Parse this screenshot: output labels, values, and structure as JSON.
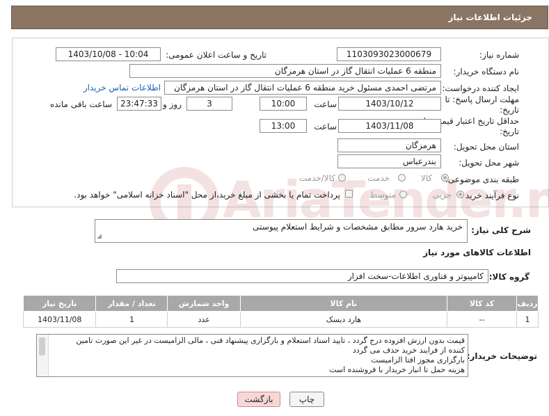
{
  "header": {
    "title": "جزئیات اطلاعات نیاز"
  },
  "form": {
    "need_number": {
      "label": "شماره نیاز:",
      "value": "1103093023000679"
    },
    "announce": {
      "label": "تاریخ و ساعت اعلان عمومی:",
      "value": "1403/10/08 - 10:04"
    },
    "buyer_org": {
      "label": "نام دستگاه خریدار:",
      "value": "منطقه 6 عملیات انتقال گاز در استان هرمزگان"
    },
    "creator": {
      "label": "ایجاد کننده درخواست:",
      "value": "مرتضی احمدی مسئول خرید منطقه 6 عملیات انتقال گاز در استان هرمزگان",
      "contact_link": "اطلاعات تماس خریدار"
    },
    "deadline": {
      "label_line1": "مهلت ارسال پاسخ: تا",
      "label_line2": "تاریخ:",
      "date": "1403/10/12",
      "time_label": "ساعت",
      "time": "10:00",
      "days": "3",
      "days_label": "روز و",
      "remaining": "23:47:33",
      "remaining_label": "ساعت باقی مانده"
    },
    "validity": {
      "label_line1": "حداقل تاریخ اعتبار قیمت: تا",
      "label_line2": "تاریخ:",
      "date": "1403/11/08",
      "time_label": "ساعت",
      "time": "13:00"
    },
    "province": {
      "label": "استان محل تحویل:",
      "value": "هرمزگان"
    },
    "city": {
      "label": "شهر محل تحویل:",
      "value": "بندرعباس"
    },
    "category": {
      "label": "طبقه بندی موضوعی:",
      "options": [
        "کالا",
        "خدمت",
        "کالا/خدمت"
      ],
      "selected": "کالا"
    },
    "process": {
      "label": "نوع فرآیند خرید :",
      "options": [
        "جزیی",
        "متوسط"
      ],
      "selected": "جزیی",
      "payment_note": "پرداخت تمام یا بخشی از مبلغ خرید،از محل \"اسناد خزانه اسلامی\" خواهد بود."
    }
  },
  "description": {
    "label": "شرح کلی نیاز:",
    "value": "خرید هارد سرور مطابق مشخصات و شرایط استعلام پیوستی"
  },
  "goods_section": {
    "title": "اطلاعات کالاهای مورد نیاز"
  },
  "goods_group": {
    "label": "گروه کالا:",
    "value": "کامپیوتر و فناوری اطلاعات-سخت افزار"
  },
  "table": {
    "headers": [
      "ردیف",
      "کد کالا",
      "نام کالا",
      "واحد شمارش",
      "تعداد / مقدار",
      "تاریخ نیاز"
    ],
    "rows": [
      [
        "1",
        "--",
        "هارد دیسک",
        "عدد",
        "1",
        "1403/11/08"
      ]
    ]
  },
  "buyer_notes": {
    "label": "توضیحات خریدار:",
    "lines": [
      "قیمت بدون ارزش افزوده درج گردد ، تایید اسناد استعلام و بارگزاری پیشنهاد فنی ، مالی الزامیست در غیر این صورت تامین",
      "کننده از فرایند خرید حذف می گردد",
      "بارگزاری مجوز افتا الزامیست",
      "هزینه حمل تا انبار خریدار با فروشنده است"
    ]
  },
  "buttons": {
    "print": "چاپ",
    "back": "بازگشت"
  },
  "watermark": {
    "text": "AriaTender.net"
  }
}
